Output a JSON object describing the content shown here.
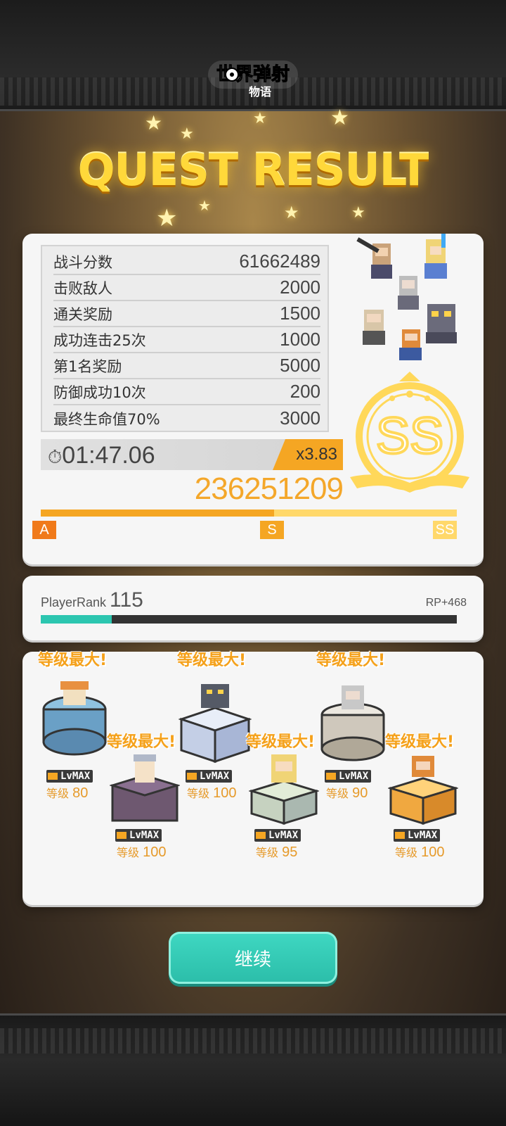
{
  "header": {
    "logo_text": "世界弹射物语"
  },
  "title": "QUEST RESULT",
  "score_rows": [
    {
      "label": "战斗分数",
      "value": "61662489"
    },
    {
      "label": "击败敌人",
      "value": "2000"
    },
    {
      "label": "通关奖励",
      "value": "1500"
    },
    {
      "label": "成功连击25次",
      "value": "1000"
    },
    {
      "label": "第1名奖励",
      "value": "5000"
    },
    {
      "label": "防御成功10次",
      "value": "200"
    },
    {
      "label": "最终生命值70%",
      "value": "3000"
    }
  ],
  "timer": "01:47.06",
  "multiplier": "x3.83",
  "total_score": "236251209",
  "grade": {
    "rank": "SS",
    "marks": [
      "A",
      "S",
      "SS"
    ],
    "progress": 0.56
  },
  "player_rank": {
    "label": "PlayerRank",
    "value": "115",
    "rp": "RP+468",
    "progress": 0.17
  },
  "characters": [
    {
      "max_label": "等级最大!",
      "badge": "LvMAX",
      "level_label": "等级",
      "level": "80"
    },
    {
      "max_label": "等级最大!",
      "badge": "LvMAX",
      "level_label": "等级",
      "level": "100"
    },
    {
      "max_label": "等级最大!",
      "badge": "LvMAX",
      "level_label": "等级",
      "level": "100"
    },
    {
      "max_label": "等级最大!",
      "badge": "LvMAX",
      "level_label": "等级",
      "level": "95"
    },
    {
      "max_label": "等级最大!",
      "badge": "LvMAX",
      "level_label": "等级",
      "level": "90"
    },
    {
      "max_label": "等级最大!",
      "badge": "LvMAX",
      "level_label": "等级",
      "level": "100"
    }
  ],
  "continue_label": "继续",
  "colors": {
    "accent_orange": "#f5a623",
    "teal": "#2cc6b0",
    "gold": "#ffd83a"
  }
}
